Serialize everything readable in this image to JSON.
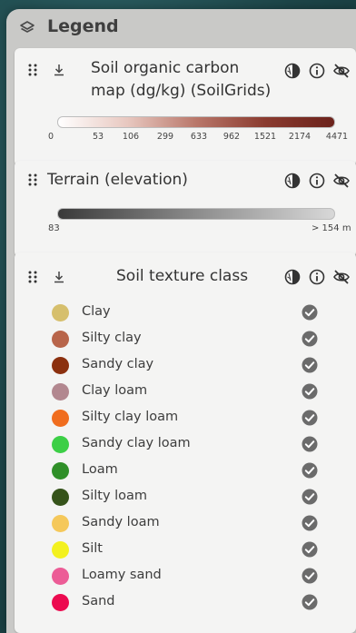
{
  "legend": {
    "title": "Legend",
    "icon": "layers-icon"
  },
  "soc": {
    "title_line1": "Soil organic carbon",
    "title_line2": "map (dg/kg) (SoilGrids)",
    "ramp_colors": [
      "#ffffff",
      "#e8c8c0",
      "#b9776a",
      "#8a3b2f",
      "#6b221b"
    ],
    "ticks": [
      "0",
      "53",
      "106",
      "299",
      "633",
      "962",
      "1521",
      "2174",
      "4471"
    ],
    "icons": [
      "drag-handle-icon",
      "download-icon",
      "opacity-icon",
      "info-icon",
      "hide-icon"
    ]
  },
  "terrain": {
    "title": "Terrain (elevation)",
    "ramp_colors": [
      "#3a3a3a",
      "#8c8c8c",
      "#d8d8d8"
    ],
    "min_label": "83",
    "max_label": "> 154 m",
    "icons": [
      "drag-handle-icon",
      "opacity-icon",
      "info-icon",
      "hide-icon"
    ]
  },
  "texture": {
    "title": "Soil texture class",
    "icons": [
      "drag-handle-icon",
      "download-icon",
      "opacity-icon",
      "info-icon",
      "hide-icon"
    ],
    "classes": [
      {
        "label": "Clay",
        "color": "#d6bf6c"
      },
      {
        "label": "Silty clay",
        "color": "#b8654a"
      },
      {
        "label": "Sandy clay",
        "color": "#8b300e"
      },
      {
        "label": "Clay loam",
        "color": "#b2878f"
      },
      {
        "label": "Silty clay loam",
        "color": "#f06d1e"
      },
      {
        "label": "Sandy clay loam",
        "color": "#3ccf46"
      },
      {
        "label": "Loam",
        "color": "#2f8f28"
      },
      {
        "label": "Silty loam",
        "color": "#35531a"
      },
      {
        "label": "Sandy loam",
        "color": "#f5c85a"
      },
      {
        "label": "Silt",
        "color": "#f3f11f"
      },
      {
        "label": "Loamy sand",
        "color": "#ec5c96"
      },
      {
        "label": "Sand",
        "color": "#ec0a4f"
      }
    ]
  }
}
